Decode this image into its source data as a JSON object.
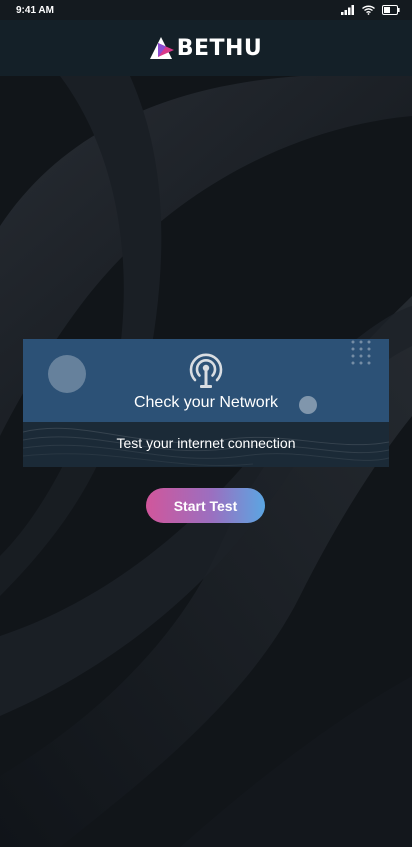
{
  "status_bar": {
    "time": "9:41 AM",
    "icons": [
      "signal-icon",
      "wifi-icon",
      "battery-icon"
    ]
  },
  "header": {
    "logo_text": "BETHU",
    "logo_mark": "triangle-logo-mark"
  },
  "card": {
    "icon": "broadcast-tower-icon",
    "title": "Check your Network",
    "subtitle": "Test your internet connection"
  },
  "actions": {
    "start_label": "Start Test"
  },
  "colors": {
    "background": "#0f1318",
    "header": "#142028",
    "card_top": "#2c5176",
    "card_bottom": "#1b2a37",
    "button_gradient_start": "#d1569b",
    "button_gradient_end": "#5ba6e2",
    "logo_pink": "#d93a8a",
    "logo_purple": "#8a4bd1"
  }
}
